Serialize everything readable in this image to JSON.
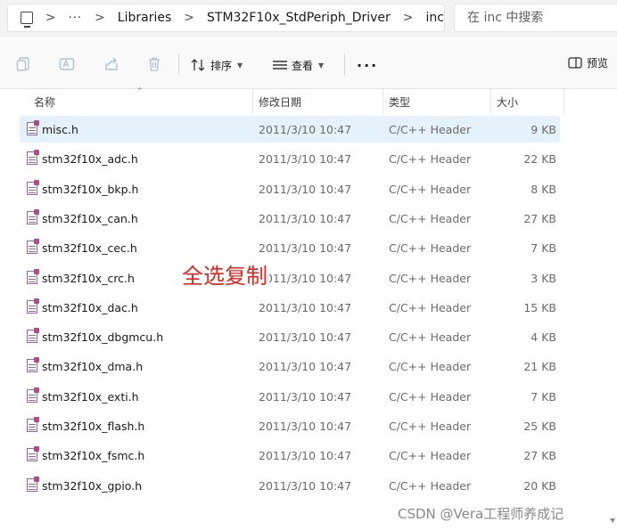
{
  "address_bar": {
    "crumbs": [
      "Libraries",
      "STM32F10x_StdPeriph_Driver",
      "inc"
    ],
    "overflow": "···",
    "separator": ">"
  },
  "search": {
    "placeholder": "在 inc 中搜索"
  },
  "toolbar": {
    "sort_label": "排序",
    "view_label": "查看",
    "more_label": "···",
    "preview_label": "预览"
  },
  "columns": {
    "name": "名称",
    "date": "修改日期",
    "type": "类型",
    "size": "大小"
  },
  "files": [
    {
      "name": "misc.h",
      "date": "2011/3/10 10:47",
      "type": "C/C++ Header",
      "size": "9 KB",
      "selected": true
    },
    {
      "name": "stm32f10x_adc.h",
      "date": "2011/3/10 10:47",
      "type": "C/C++ Header",
      "size": "22 KB"
    },
    {
      "name": "stm32f10x_bkp.h",
      "date": "2011/3/10 10:47",
      "type": "C/C++ Header",
      "size": "8 KB"
    },
    {
      "name": "stm32f10x_can.h",
      "date": "2011/3/10 10:47",
      "type": "C/C++ Header",
      "size": "27 KB"
    },
    {
      "name": "stm32f10x_cec.h",
      "date": "2011/3/10 10:47",
      "type": "C/C++ Header",
      "size": "7 KB"
    },
    {
      "name": "stm32f10x_crc.h",
      "date": "2011/3/10 10:47",
      "type": "C/C++ Header",
      "size": "3 KB"
    },
    {
      "name": "stm32f10x_dac.h",
      "date": "2011/3/10 10:47",
      "type": "C/C++ Header",
      "size": "15 KB"
    },
    {
      "name": "stm32f10x_dbgmcu.h",
      "date": "2011/3/10 10:47",
      "type": "C/C++ Header",
      "size": "4 KB"
    },
    {
      "name": "stm32f10x_dma.h",
      "date": "2011/3/10 10:47",
      "type": "C/C++ Header",
      "size": "21 KB"
    },
    {
      "name": "stm32f10x_exti.h",
      "date": "2011/3/10 10:47",
      "type": "C/C++ Header",
      "size": "7 KB"
    },
    {
      "name": "stm32f10x_flash.h",
      "date": "2011/3/10 10:47",
      "type": "C/C++ Header",
      "size": "25 KB"
    },
    {
      "name": "stm32f10x_fsmc.h",
      "date": "2011/3/10 10:47",
      "type": "C/C++ Header",
      "size": "27 KB"
    },
    {
      "name": "stm32f10x_gpio.h",
      "date": "2011/3/10 10:47",
      "type": "C/C++ Header",
      "size": "20 KB"
    }
  ],
  "annotation": "全选复制",
  "watermark": "CSDN @Vera工程师养成记",
  "colors": {
    "selected_row": "#e5f1fb",
    "annotation": "#e0251f",
    "file_icon_accent": "#b24a8e"
  }
}
